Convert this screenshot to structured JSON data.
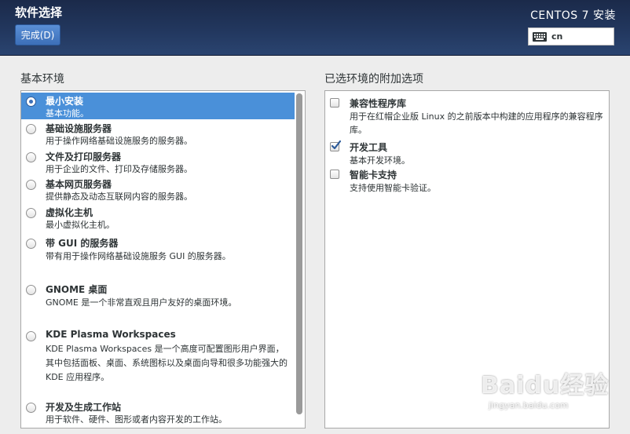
{
  "header": {
    "title": "软件选择",
    "done_label": "完成(D)",
    "install_title": "CENTOS 7 安装",
    "keyboard_layout": "cn"
  },
  "base_env": {
    "label": "基本环境",
    "items": [
      {
        "title": "最小安装",
        "desc": "基本功能。",
        "selected": true
      },
      {
        "title": "基础设施服务器",
        "desc": "用于操作网络基础设施服务的服务器。",
        "selected": false
      },
      {
        "title": "文件及打印服务器",
        "desc": "用于企业的文件、打印及存储服务器。",
        "selected": false
      },
      {
        "title": "基本网页服务器",
        "desc": "提供静态及动态互联网内容的服务器。",
        "selected": false
      },
      {
        "title": "虚拟化主机",
        "desc": "最小虚拟化主机。",
        "selected": false
      },
      {
        "title": "带 GUI 的服务器",
        "desc": "带有用于操作网络基础设施服务 GUI 的服务器。",
        "selected": false
      },
      {
        "title": "GNOME 桌面",
        "desc": "GNOME 是一个非常直观且用户友好的桌面环境。",
        "selected": false
      },
      {
        "title": "KDE Plasma Workspaces",
        "desc": "KDE Plasma Workspaces 是一个高度可配置图形用户界面，其中包括面板、桌面、系统图标以及桌面向导和很多功能强大的 KDE 应用程序。",
        "selected": false
      },
      {
        "title": "开发及生成工作站",
        "desc": "用于软件、硬件、图形或者内容开发的工作站。",
        "selected": false
      }
    ]
  },
  "addons": {
    "label": "已选环境的附加选项",
    "items": [
      {
        "title": "兼容性程序库",
        "desc": "用于在红帽企业版 Linux 的之前版本中构建的应用程序的兼容程序库。",
        "checked": false
      },
      {
        "title": "开发工具",
        "desc": "基本开发环境。",
        "checked": true
      },
      {
        "title": "智能卡支持",
        "desc": "支持使用智能卡验证。",
        "checked": false
      }
    ]
  },
  "watermark": {
    "logo": "Baidu经验",
    "url": "jingyan.baidu.com"
  },
  "colors": {
    "header": "#22375e",
    "selection": "#4a90d9",
    "button": "#3c6fb8"
  }
}
